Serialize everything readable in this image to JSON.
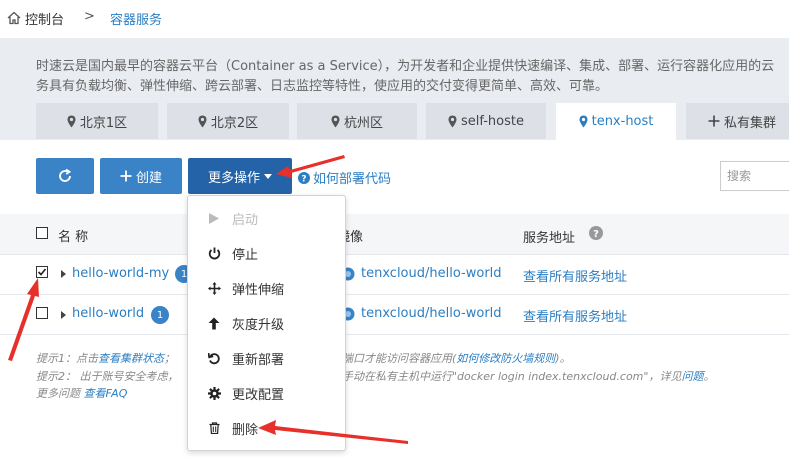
{
  "breadcrumb": {
    "home": "控制台",
    "current": "容器服务"
  },
  "description": {
    "line1": "时速云是国内最早的容器云平台（Container as a Service），为开发者和企业提供快速编译、集成、部署、运行容器化应用的云",
    "line2": "务具有负载均衡、弹性伸缩、跨云部署、日志监控等特性，使应用的交付变得更简单、高效、可靠。"
  },
  "tabs": [
    {
      "label": "北京1区",
      "icon": "location-pin-icon"
    },
    {
      "label": "北京2区",
      "icon": "location-pin-icon"
    },
    {
      "label": "杭州区",
      "icon": "location-pin-icon"
    },
    {
      "label": "self-hoste",
      "icon": "location-pin-icon"
    },
    {
      "label": "tenx-host",
      "icon": "location-pin-icon",
      "active": true
    },
    {
      "label": "私有集群",
      "icon": "plus-icon"
    }
  ],
  "toolbar": {
    "create_label": "创建",
    "more_label": "更多操作",
    "howto_label": "如何部署代码",
    "search_placeholder": "搜索"
  },
  "table": {
    "columns": {
      "name": "名 称",
      "image": "镜像",
      "address": "服务地址"
    },
    "rows": [
      {
        "name": "hello-world-my",
        "count": "1",
        "image": "tenxcloud/hello-world",
        "address": "查看所有服务地址",
        "checked": true
      },
      {
        "name": "hello-world",
        "count": "1",
        "image": "tenxcloud/hello-world",
        "address": "查看所有服务地址",
        "checked": false
      }
    ]
  },
  "notes": {
    "line1_prefix": "提示1：点击",
    "line1_link": "查看集群状态",
    "line1_after": "；",
    "line1_tail": "端口才能访问容器应用(",
    "line1_link2": "如何修改防火墙规则",
    "line1_end": ")。",
    "line2_prefix": "提示2：  出于账号安全考虑，",
    "line2_tail": "手动在私有主机中运行\"docker login index.tenxcloud.com\"，详见",
    "line2_link": "问题",
    "line2_end": "。",
    "line3_prefix": "更多问题 ",
    "line3_link": "查看FAQ"
  },
  "menu": {
    "items": [
      {
        "label": "启动",
        "icon": "play-icon",
        "disabled": true
      },
      {
        "label": "停止",
        "icon": "power-icon",
        "disabled": false
      },
      {
        "label": "弹性伸缩",
        "icon": "move-arrows-icon",
        "disabled": false
      },
      {
        "label": "灰度升级",
        "icon": "arrow-up-icon",
        "disabled": false
      },
      {
        "label": "重新部署",
        "icon": "redo-icon",
        "disabled": false
      },
      {
        "label": "更改配置",
        "icon": "gear-icon",
        "disabled": false
      },
      {
        "label": "删除",
        "icon": "trash-icon",
        "disabled": false
      }
    ]
  },
  "colors": {
    "primary": "#3a83c7",
    "link": "#2a7ec3",
    "arrow": "#e8302a"
  }
}
